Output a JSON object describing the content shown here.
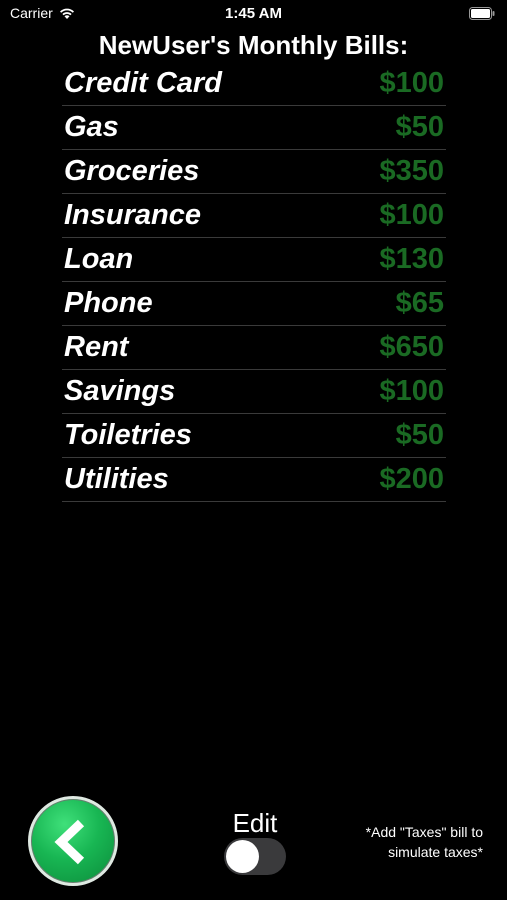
{
  "status_bar": {
    "carrier": "Carrier",
    "time": "1:45 AM",
    "wifi_icon": "wifi-icon",
    "battery_icon": "battery-icon"
  },
  "title": "NewUser's Monthly Bills:",
  "bills": [
    {
      "name": "Credit Card",
      "amount": "$100"
    },
    {
      "name": "Gas",
      "amount": "$50"
    },
    {
      "name": "Groceries",
      "amount": "$350"
    },
    {
      "name": "Insurance",
      "amount": "$100"
    },
    {
      "name": "Loan",
      "amount": "$130"
    },
    {
      "name": "Phone",
      "amount": "$65"
    },
    {
      "name": "Rent",
      "amount": "$650"
    },
    {
      "name": "Savings",
      "amount": "$100"
    },
    {
      "name": "Toiletries",
      "amount": "$50"
    },
    {
      "name": "Utilities",
      "amount": "$200"
    }
  ],
  "controls": {
    "back_icon": "chevron-left-icon",
    "edit_label": "Edit",
    "edit_toggle_on": false,
    "taxes_note": "*Add \"Taxes\" bill to simulate taxes*"
  },
  "colors": {
    "background": "#000000",
    "amount": "#1a6a23",
    "back_button": "#18b653"
  }
}
